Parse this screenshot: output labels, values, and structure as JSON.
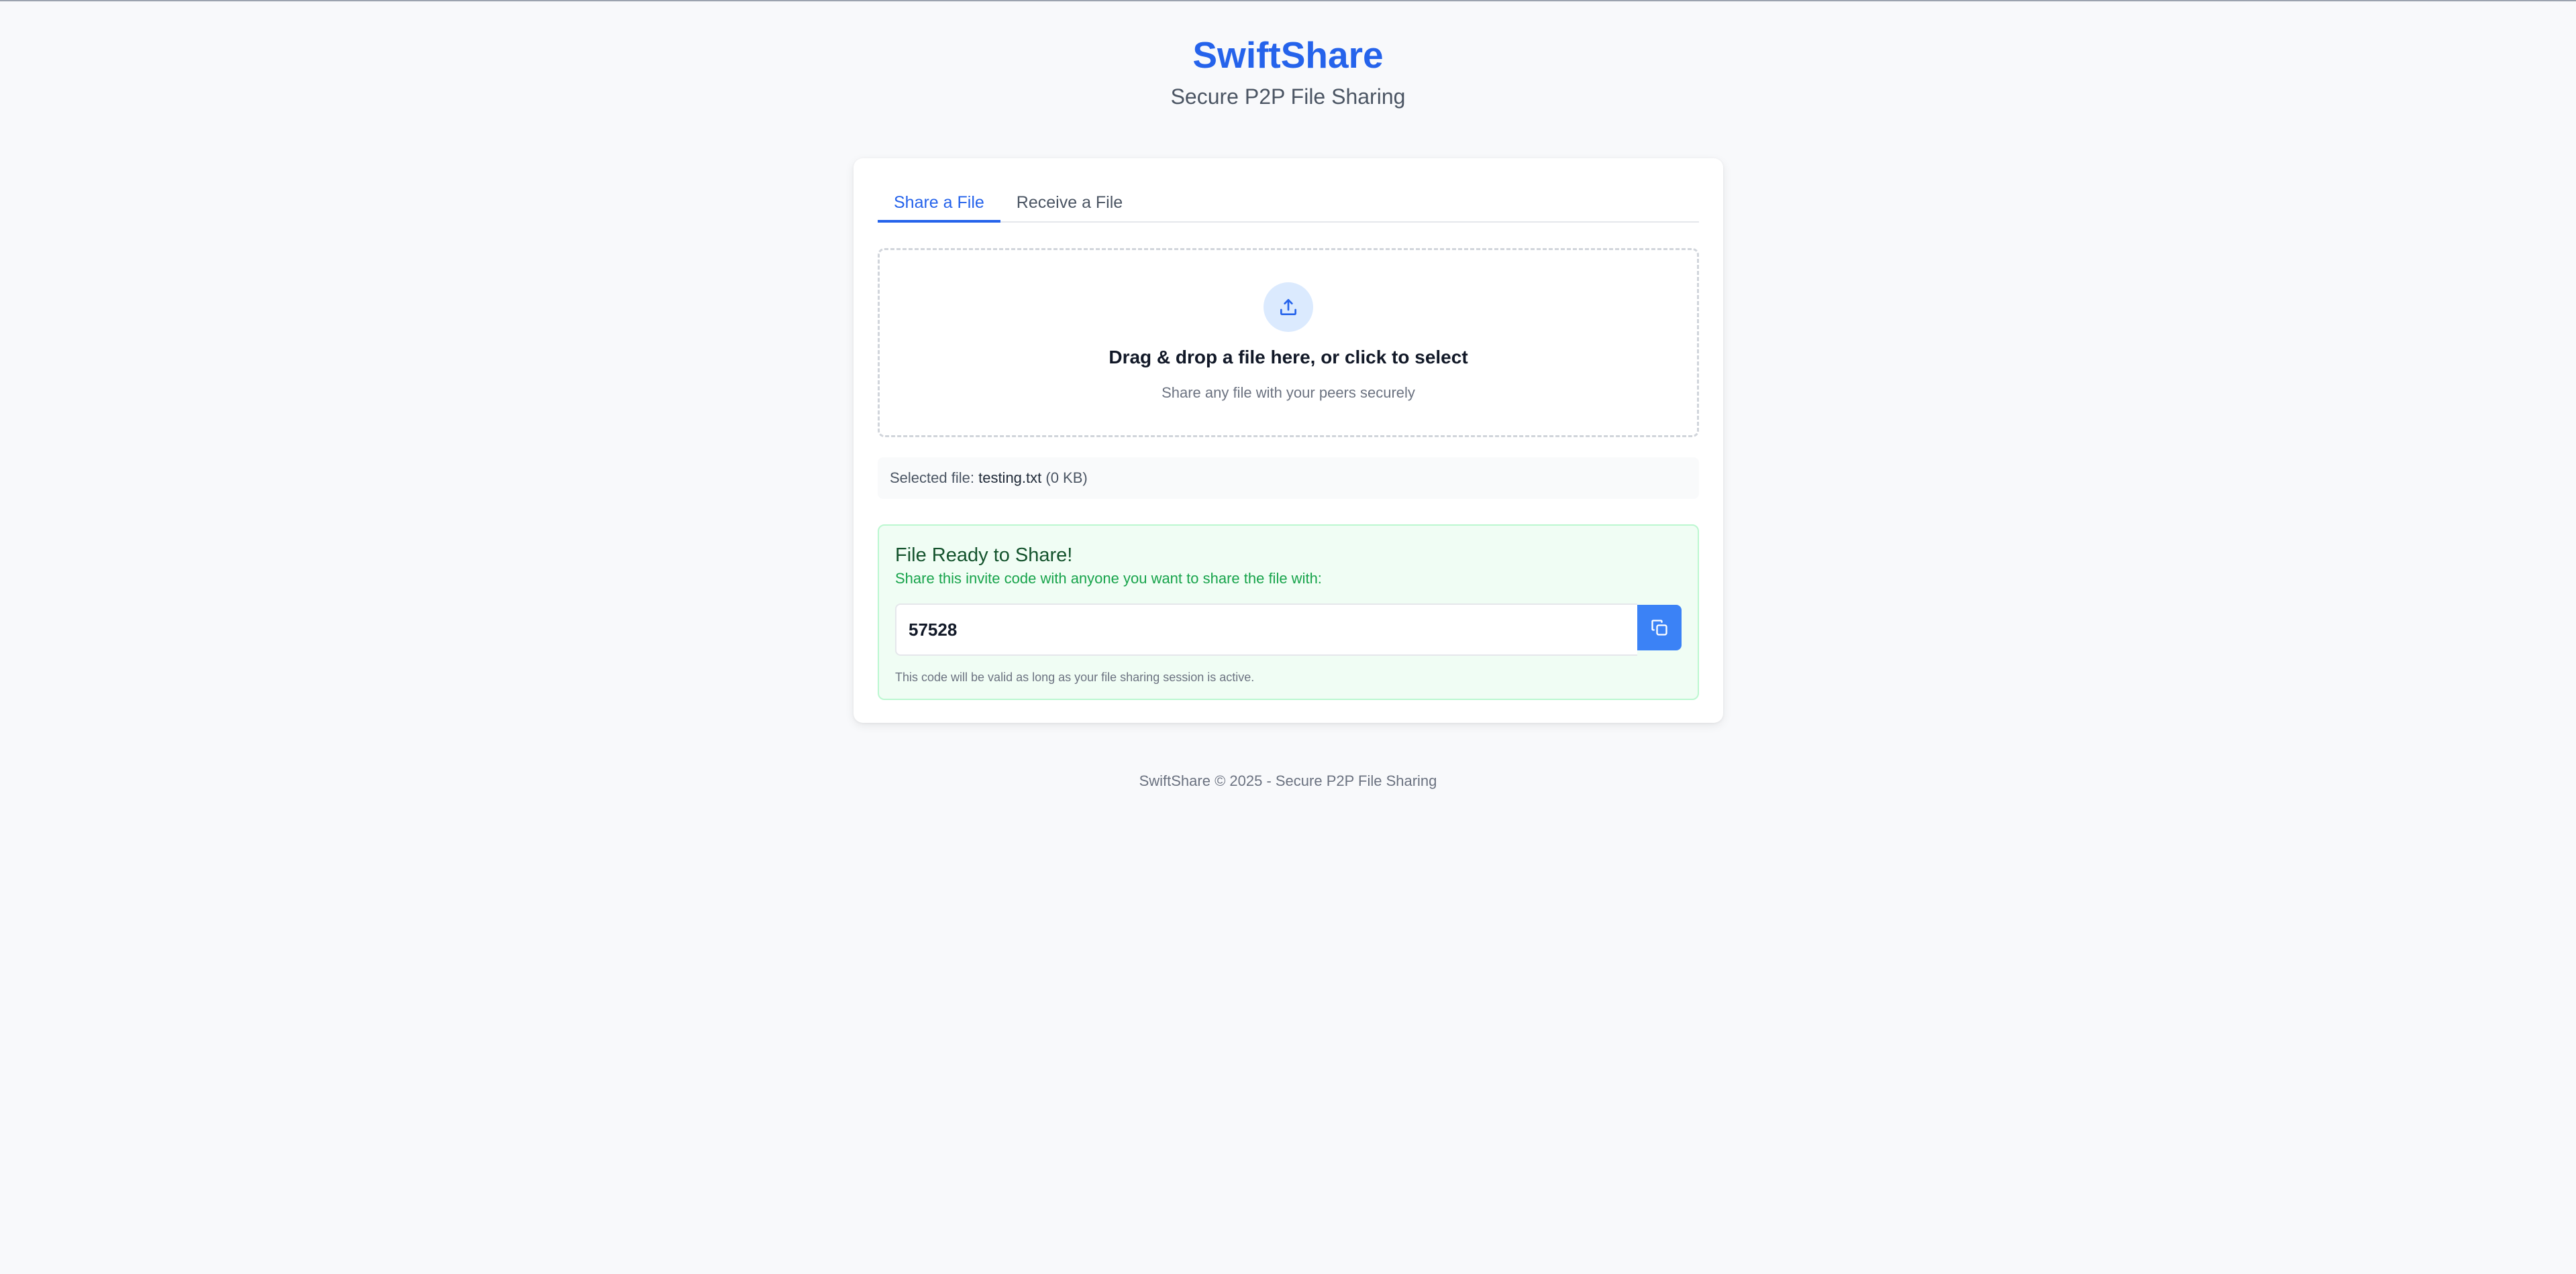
{
  "header": {
    "title": "SwiftShare",
    "subtitle": "Secure P2P File Sharing"
  },
  "tabs": [
    {
      "label": "Share a File",
      "active": true
    },
    {
      "label": "Receive a File",
      "active": false
    }
  ],
  "dropzone": {
    "icon": "upload-icon",
    "title": "Drag & drop a file here, or click to select",
    "subtitle": "Share any file with your peers securely"
  },
  "selected_file": {
    "prefix": "Selected file:",
    "name": "testing.txt",
    "size": "(0 KB)"
  },
  "share_result": {
    "title": "File Ready to Share!",
    "subtitle": "Share this invite code with anyone you want to share the file with:",
    "invite_code": "57528",
    "copy_icon": "copy-icon",
    "note": "This code will be valid as long as your file sharing session is active."
  },
  "footer": {
    "text": "SwiftShare © 2025 - Secure P2P File Sharing"
  },
  "colors": {
    "accent": "#2563eb",
    "button": "#3b82f6",
    "success_bg": "#f0fdf4",
    "success_text": "#16a34a",
    "background": "#f8f9fb"
  }
}
